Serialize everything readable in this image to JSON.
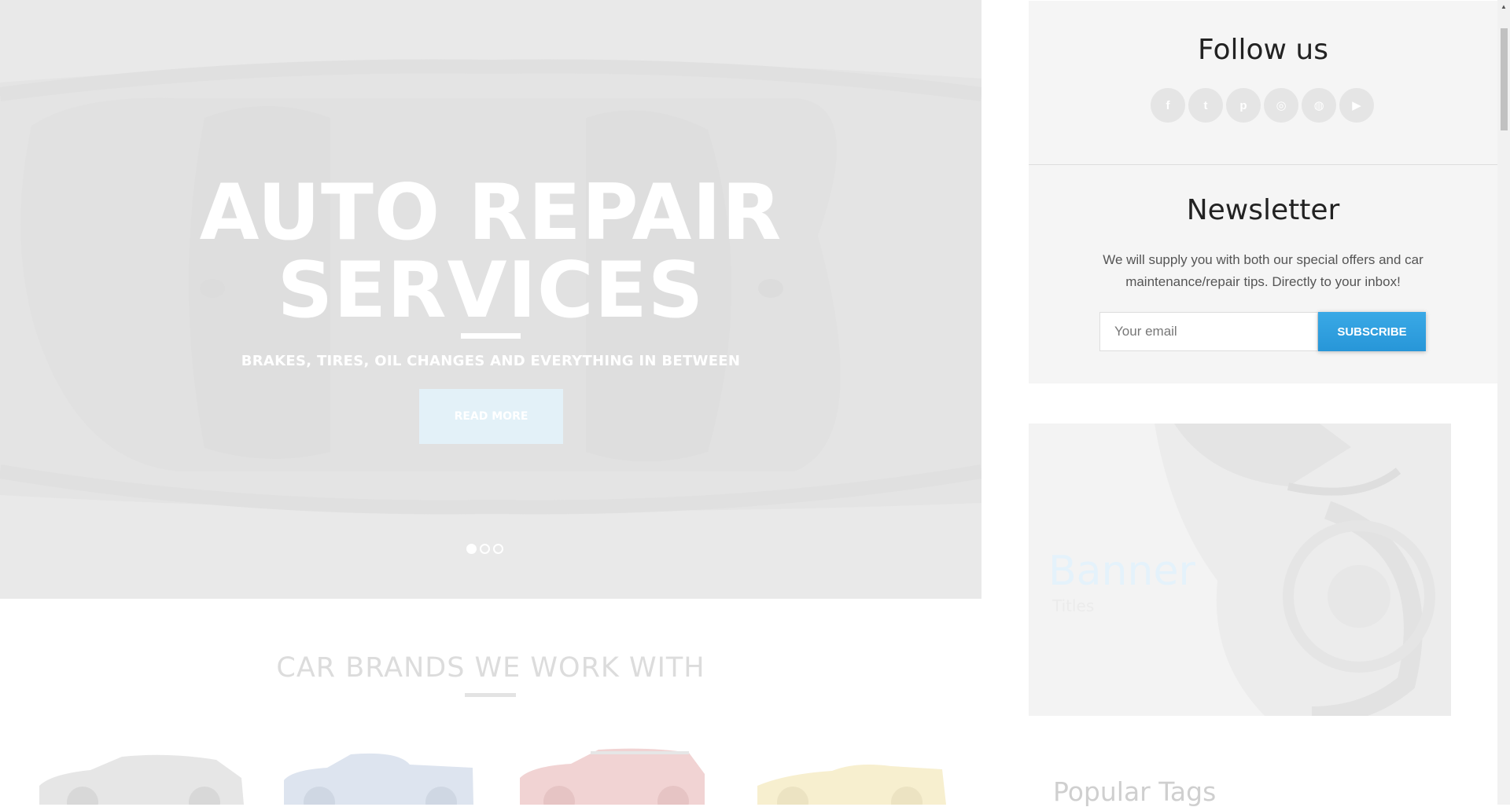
{
  "hero": {
    "title_line1": "AUTO REPAIR",
    "title_line2": "SERVICES",
    "subtitle": "BRAKES, TIRES, OIL CHANGES AND EVERYTHING IN BETWEEN",
    "button_label": "READ MORE",
    "slides": [
      "slide-1",
      "slide-2",
      "slide-3"
    ],
    "active_slide": 1
  },
  "brands": {
    "title": "CAR BRANDS WE WORK WITH",
    "cars": [
      {
        "icon": "silver-suv",
        "color": "#e6e6e6"
      },
      {
        "icon": "blue-pickup",
        "color": "#dde4ef"
      },
      {
        "icon": "red-suv",
        "color": "#f1d3d3"
      },
      {
        "icon": "yellow-sportscar",
        "color": "#f7efcf"
      }
    ]
  },
  "sidebar": {
    "follow_title": "Follow us",
    "socials": [
      {
        "name": "facebook",
        "glyph": "f"
      },
      {
        "name": "twitter",
        "glyph": "t"
      },
      {
        "name": "pinterest",
        "glyph": "p"
      },
      {
        "name": "instagram",
        "glyph": "◎"
      },
      {
        "name": "dribbble",
        "glyph": "◍"
      },
      {
        "name": "youtube",
        "glyph": "▶"
      }
    ],
    "newsletter_title": "Newsletter",
    "newsletter_text": "We will supply you with both our special offers and car maintenance/repair tips. Directly to your inbox!",
    "email_placeholder": "Your email",
    "subscribe_label": "SUBSCRIBE",
    "banner_title": "Banner",
    "banner_subtitle": "Titles",
    "tags_title": "Popular Tags"
  },
  "colors": {
    "accent": "#2a9ad9",
    "hero_bg": "#e9e9e9",
    "widget_bg": "#f5f5f5"
  }
}
